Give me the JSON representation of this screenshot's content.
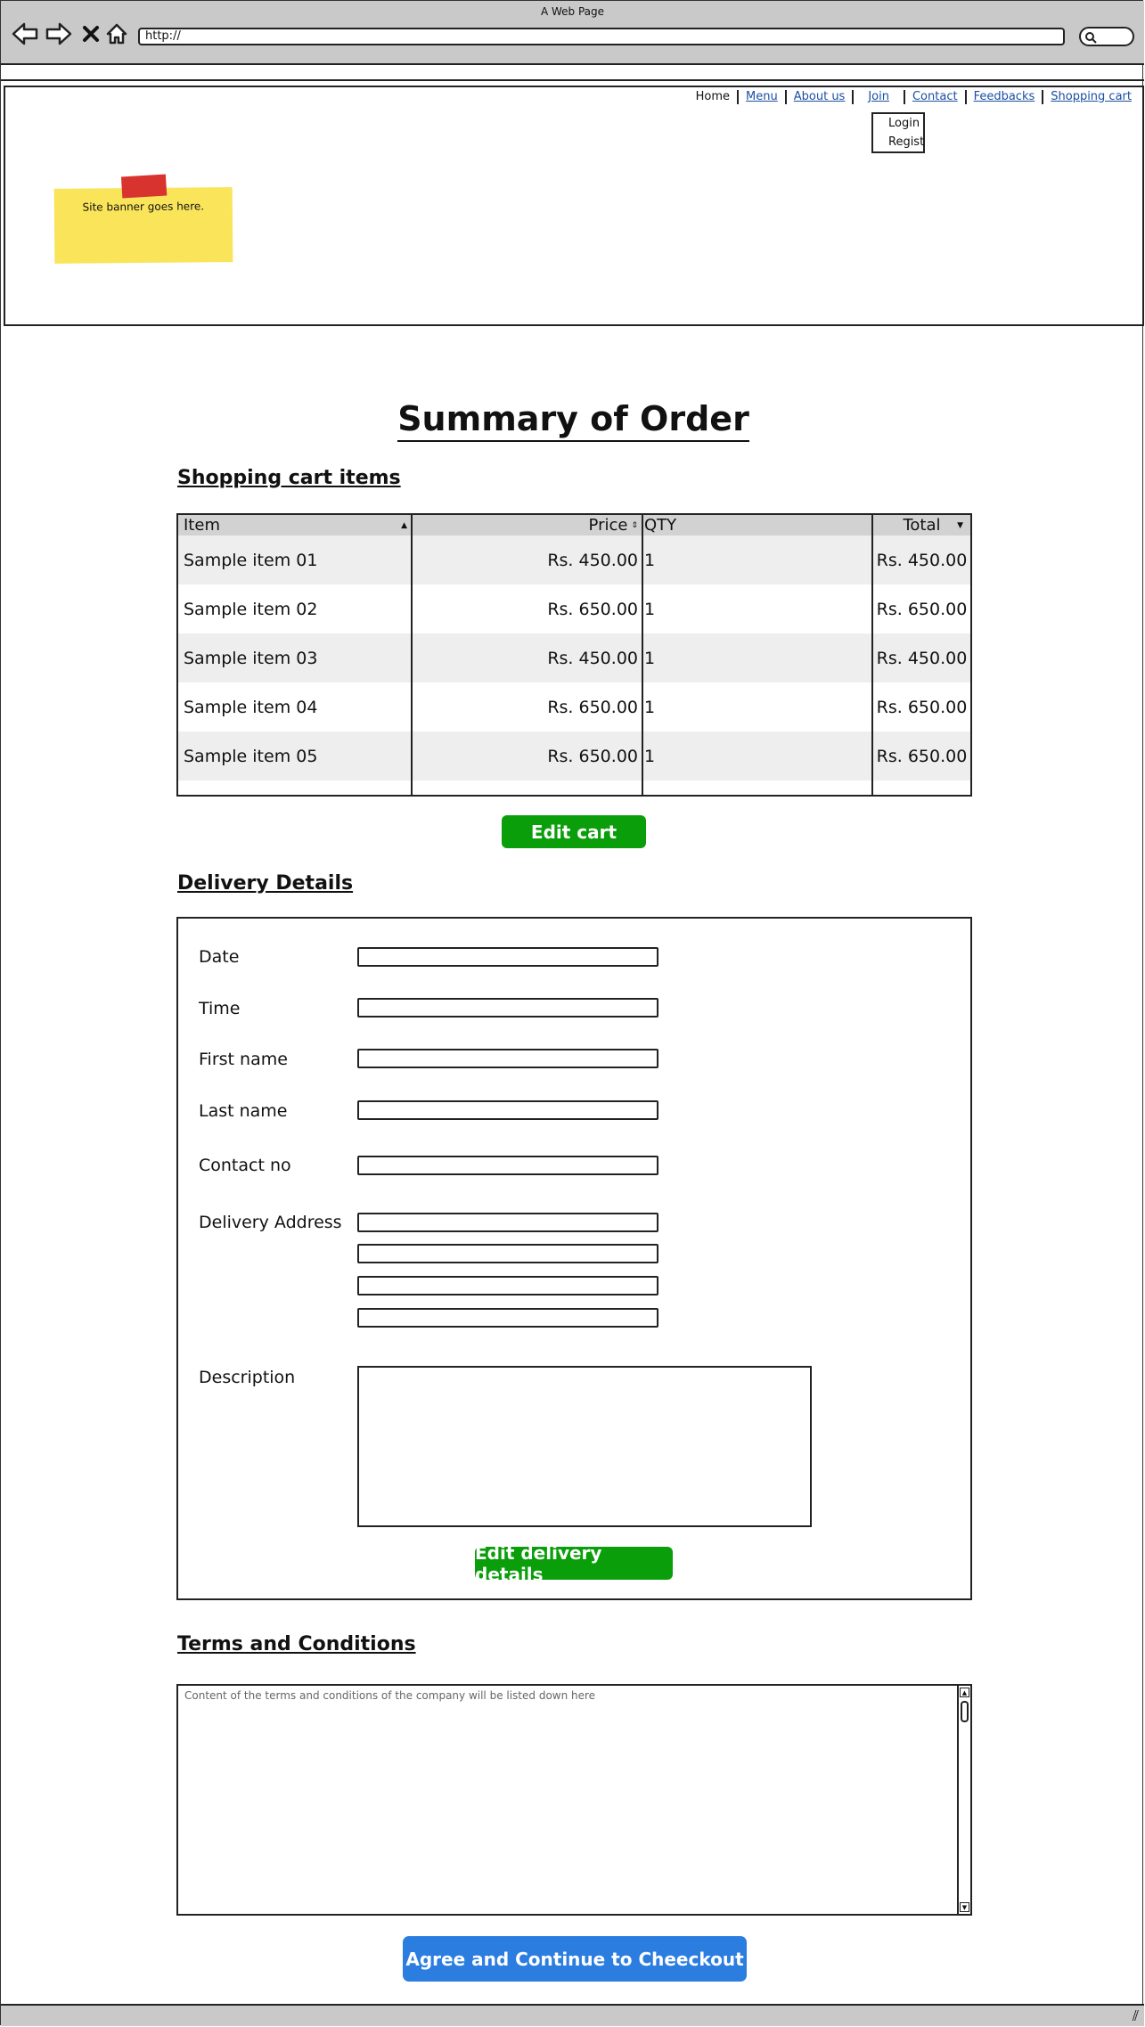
{
  "window": {
    "title": "A Web Page",
    "url": "http://"
  },
  "nav": {
    "items": [
      "Home",
      "Menu",
      "About us",
      "Join",
      "Contact",
      "Feedbacks",
      "Shopping cart"
    ]
  },
  "join_dropdown": {
    "items": [
      "Login",
      "Regist"
    ]
  },
  "banner": {
    "text": "Site banner goes here."
  },
  "page": {
    "title": "Summary of Order"
  },
  "cart": {
    "heading": "Shopping cart items",
    "columns": [
      "Item",
      "Price",
      "QTY",
      "Total"
    ],
    "rows": [
      {
        "item": "Sample item 01",
        "price": "Rs. 450.00",
        "qty": "1",
        "total": "Rs. 450.00"
      },
      {
        "item": "Sample item 02",
        "price": "Rs. 650.00",
        "qty": "1",
        "total": "Rs. 650.00"
      },
      {
        "item": "Sample item 03",
        "price": "Rs. 450.00",
        "qty": "1",
        "total": "Rs. 450.00"
      },
      {
        "item": "Sample item 04",
        "price": "Rs. 650.00",
        "qty": "1",
        "total": "Rs. 650.00"
      },
      {
        "item": "Sample item 05",
        "price": "Rs. 650.00",
        "qty": "1",
        "total": "Rs. 650.00"
      }
    ],
    "edit_button": "Edit cart"
  },
  "delivery": {
    "heading": "Delivery Details",
    "labels": {
      "date": "Date",
      "time": "Time",
      "first_name": "First name",
      "last_name": "Last name",
      "contact_no": "Contact no",
      "address": "Delivery Address",
      "description": "Description"
    },
    "edit_button": "Edit delivery details"
  },
  "terms": {
    "heading": "Terms and Conditions",
    "content": "Content of the terms and conditions of the company will be listed down here"
  },
  "checkout_button": "Agree and Continue to Cheeckout",
  "icons": [
    "back-icon",
    "forward-icon",
    "close-icon",
    "home-icon",
    "search-icon",
    "resize-grip-icon"
  ],
  "colors": {
    "green_button": "#0a9e0a",
    "blue_button": "#2b7de0",
    "sticky_note": "#f9e45a",
    "tape": "#d9332f",
    "link": "#1a4fa3"
  }
}
